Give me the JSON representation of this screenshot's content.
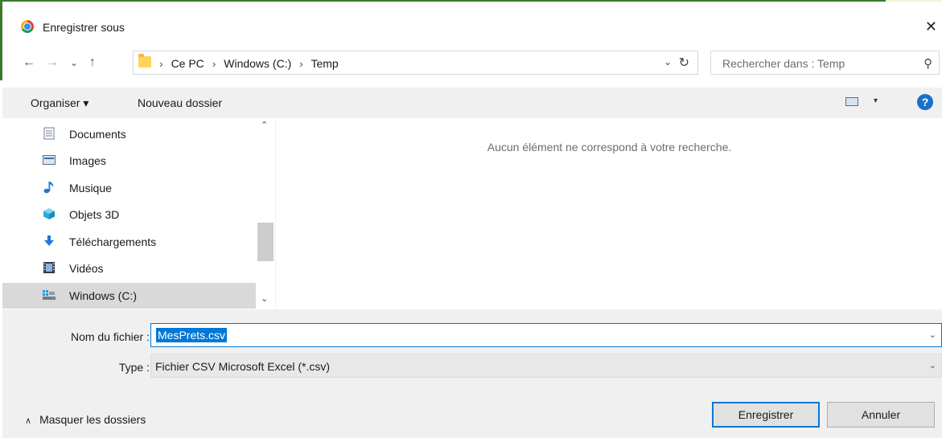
{
  "window": {
    "title": "Enregistrer sous",
    "close_glyph": "✕"
  },
  "nav": {
    "back": "←",
    "forward": "→",
    "recent": "⌄",
    "up": "↑"
  },
  "address": {
    "crumbs": [
      "Ce PC",
      "Windows (C:)",
      "Temp"
    ],
    "separator": "›",
    "dropdown": "⌄",
    "refresh": "↻"
  },
  "search": {
    "placeholder": "Rechercher dans : Temp",
    "icon": "⚲"
  },
  "toolbar": {
    "organize_label": "Organiser ▾",
    "new_folder_label": "Nouveau dossier",
    "help": "?",
    "view_dd": "▾"
  },
  "sidebar": {
    "items": [
      {
        "label": "Documents",
        "icon": "documents-icon"
      },
      {
        "label": "Images",
        "icon": "images-icon"
      },
      {
        "label": "Musique",
        "icon": "music-icon"
      },
      {
        "label": "Objets 3D",
        "icon": "3d-objects-icon"
      },
      {
        "label": "Téléchargements",
        "icon": "downloads-icon"
      },
      {
        "label": "Vidéos",
        "icon": "videos-icon"
      },
      {
        "label": "Windows (C:)",
        "icon": "drive-icon",
        "selected": true
      }
    ],
    "scroll_up": "⌃",
    "scroll_down": "⌄"
  },
  "content": {
    "empty_message": "Aucun élément ne correspond à votre recherche."
  },
  "form": {
    "filename_label": "Nom du fichier :",
    "filename_value": "MesPrets.csv",
    "type_label": "Type :",
    "type_value": "Fichier CSV Microsoft Excel (*.csv)",
    "dropdown": "⌄"
  },
  "footer": {
    "hide_folders_label": "Masquer les dossiers",
    "hide_chevron": "∧",
    "save_label": "Enregistrer",
    "cancel_label": "Annuler"
  },
  "colors": {
    "accent": "#0078d7",
    "help": "#1a6fc9",
    "folder": "#ffd35c"
  }
}
